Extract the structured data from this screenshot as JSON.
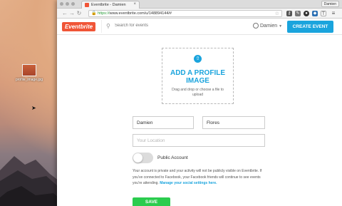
{
  "desktop": {
    "file_name": "profile_image.jpg"
  },
  "browser": {
    "tab_title": "Eventbrite - Damien",
    "profile_badge": "Damien",
    "url_scheme": "https://",
    "url_rest": "www.eventbrite.com/u/148894144/#"
  },
  "site": {
    "logo": "Eventbrite",
    "search_placeholder": "Search for events",
    "user_name": "Damien",
    "create_event": "CREATE EVENT"
  },
  "profile": {
    "upload_title": "ADD A PROFILE IMAGE",
    "upload_subtitle": "Drag and drop or choose a file to upload",
    "first_name": "Damien",
    "last_name": "Flores",
    "location_placeholder": "Your Location",
    "public_account_label": "Public Account",
    "public_account_on": false,
    "privacy_text": "Your account is private and your activity will not be publicly visible on Eventbrite. If you've connected to Facebook, your Facebook friends will continue to see events you're attending.",
    "privacy_link": "Manage your social settings here.",
    "save": "SAVE"
  },
  "colors": {
    "brand_orange": "#f05537",
    "accent_blue": "#1aa4dd",
    "save_green": "#2bcc4e"
  }
}
